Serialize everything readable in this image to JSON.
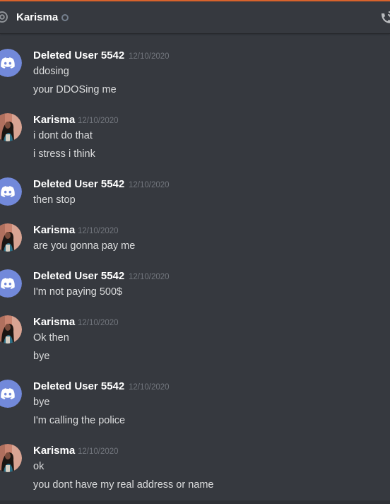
{
  "header": {
    "title": "Karisma"
  },
  "colors": {
    "background": "#36393f",
    "accent": "#d9632c",
    "discord_blurple": "#7289da",
    "username": "#ffffff",
    "timestamp": "#72767d",
    "message_text": "#dcddde"
  },
  "messages": [
    {
      "author": "Deleted User 5542",
      "avatar": "discord-logo-icon",
      "timestamp": "12/10/2020",
      "lines": [
        "ddosing",
        "your DDOSing me"
      ]
    },
    {
      "author": "Karisma",
      "avatar": "user-photo",
      "timestamp": "12/10/2020",
      "lines": [
        "i dont do that",
        "i stress i think"
      ]
    },
    {
      "author": "Deleted User 5542",
      "avatar": "discord-logo-icon",
      "timestamp": "12/10/2020",
      "lines": [
        "then stop"
      ]
    },
    {
      "author": "Karisma",
      "avatar": "user-photo",
      "timestamp": "12/10/2020",
      "lines": [
        "are you gonna pay me"
      ]
    },
    {
      "author": "Deleted User 5542",
      "avatar": "discord-logo-icon",
      "timestamp": "12/10/2020",
      "lines": [
        "I'm not paying 500$"
      ]
    },
    {
      "author": "Karisma",
      "avatar": "user-photo",
      "timestamp": "12/10/2020",
      "lines": [
        "Ok then",
        "bye"
      ]
    },
    {
      "author": "Deleted User 5542",
      "avatar": "discord-logo-icon",
      "timestamp": "12/10/2020",
      "lines": [
        "bye",
        "I'm calling the police"
      ]
    },
    {
      "author": "Karisma",
      "avatar": "user-photo",
      "timestamp": "12/10/2020",
      "lines": [
        "ok",
        "you dont have my real address or name"
      ]
    }
  ]
}
